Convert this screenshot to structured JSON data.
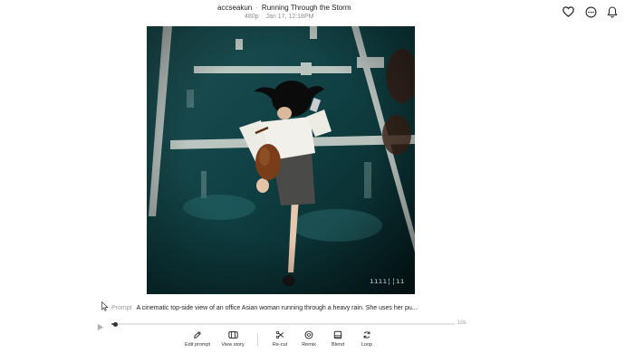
{
  "header": {
    "username": "accseakun",
    "separator": "·",
    "title": "Running Through the Storm",
    "resolution": "480p",
    "timestamp": "Jan 17, 12:18PM"
  },
  "top_icons": [
    {
      "name": "heart-icon"
    },
    {
      "name": "more-options-icon"
    },
    {
      "name": "notifications-bell-icon"
    }
  ],
  "video": {
    "watermark": "ıııı¦¦ıı"
  },
  "prompt": {
    "label": "Prompt",
    "text": "A cinematic top-side view of an office Asian woman running through a heavy rain. She uses her pu..."
  },
  "player": {
    "duration": "10s",
    "progress": 0.01
  },
  "toolbar": {
    "edit_prompt": "Edit prompt",
    "view_story": "View story",
    "recut": "Re-cut",
    "remix": "Remix",
    "blend": "Blend",
    "loop": "Loop"
  },
  "colors": {
    "video_bg": "#0e3a3d",
    "road_line": "#d8dcd6",
    "text_primary": "#1e1e1e",
    "text_muted": "#8f8f8f"
  }
}
